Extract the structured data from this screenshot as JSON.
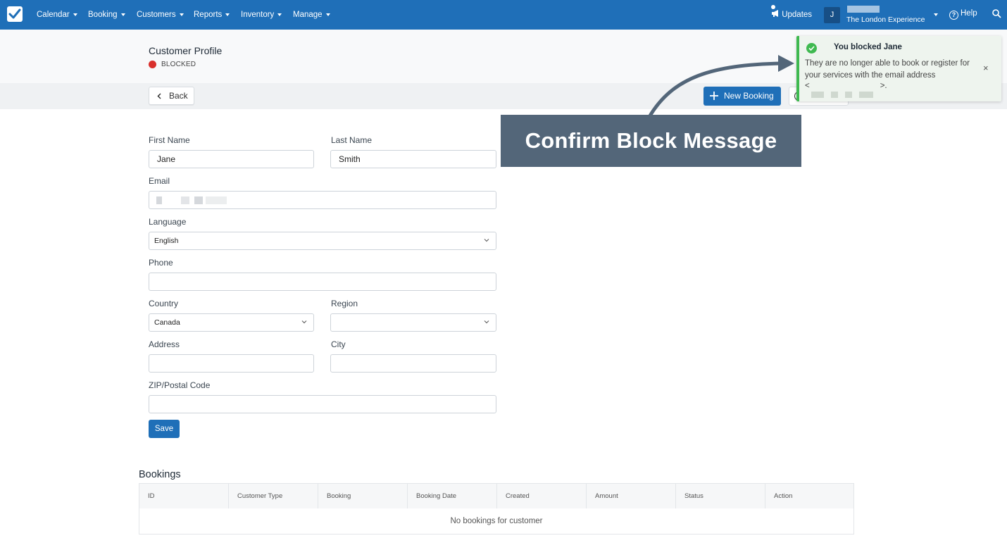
{
  "nav": {
    "items": [
      "Calendar",
      "Booking",
      "Customers",
      "Reports",
      "Inventory",
      "Manage"
    ],
    "updates_label": "Updates",
    "avatar_initial": "J",
    "account_name": "The London Experience",
    "help_label": "Help",
    "brand_color": "#1f6fb8"
  },
  "header": {
    "title": "Customer Profile",
    "status": "BLOCKED",
    "status_color": "#d9302c"
  },
  "toolbar": {
    "back_label": "Back",
    "new_booking_label": "New Booking"
  },
  "form": {
    "first_name_label": "First Name",
    "first_name_value": "Jane",
    "last_name_label": "Last Name",
    "last_name_value": "Smith",
    "email_label": "Email",
    "language_label": "Language",
    "language_value": "English",
    "phone_label": "Phone",
    "country_label": "Country",
    "country_value": "Canada",
    "region_label": "Region",
    "address_label": "Address",
    "city_label": "City",
    "zip_label": "ZIP/Postal Code",
    "save_label": "Save"
  },
  "bookings": {
    "title": "Bookings",
    "columns": [
      "ID",
      "Customer Type",
      "Booking",
      "Booking Date",
      "Created",
      "Amount",
      "Status",
      "Action"
    ],
    "empty_message": "No bookings for customer"
  },
  "callout": {
    "text": "Confirm Block Message"
  },
  "toast": {
    "title": "You blocked Jane",
    "body": "They are no longer able to book or register for your services with the email address",
    "email_open": "<",
    "email_close": ">.",
    "close_label": "×",
    "accent_color": "#3fb950"
  }
}
